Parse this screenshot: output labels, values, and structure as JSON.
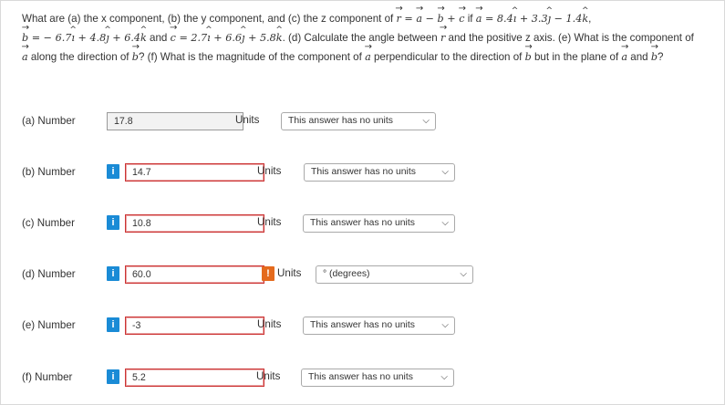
{
  "question": {
    "p1": "What are (a) the x component, (b) the y component, and (c) the z component of ",
    "p2": " if ",
    "p3": " and ",
    "p4": ". (d) Calculate the angle between ",
    "p5": " and the positive z axis. (e) What is the component of ",
    "p6": " along the direction of ",
    "p7": "? (f) What is the magnitude of the component of ",
    "p8": " perpendicular to the direction of ",
    "p9": " but in the plane of ",
    "p10": " and ",
    "p11": "?",
    "eq_r": "r = a − b + c",
    "eq_a": "a = 8.4î + 3.3ĵ − 1.4k̂",
    "eq_b": "b = − 6.7î + 4.8ĵ + 6.4k̂",
    "eq_c": "c = 2.7î + 6.6ĵ + 5.8k̂"
  },
  "rows": [
    {
      "label": "(a)   Number",
      "value": "17.8",
      "units_label": "Units",
      "unit": "This answer has no units"
    },
    {
      "label": "(b)   Number",
      "value": "14.7",
      "units_label": "Units",
      "unit": "This answer has no units"
    },
    {
      "label": "(c)   Number",
      "value": "10.8",
      "units_label": "Units",
      "unit": "This answer has no units"
    },
    {
      "label": "(d)   Number",
      "value": "60.0",
      "units_label": "Units",
      "unit": "° (degrees)"
    },
    {
      "label": "(e)   Number",
      "value": "-3",
      "units_label": "Units",
      "unit": "This answer has no units"
    },
    {
      "label": "(f)   Number",
      "value": "5.2",
      "units_label": "Units",
      "unit": "This answer has no units"
    }
  ],
  "icons": {
    "info": "i",
    "warning": "!",
    "chevron": "chevron-down-icon"
  },
  "colors": {
    "info": "#1a8bd6",
    "warning": "#e46a1d",
    "incorrect_border": "#cc3333"
  }
}
